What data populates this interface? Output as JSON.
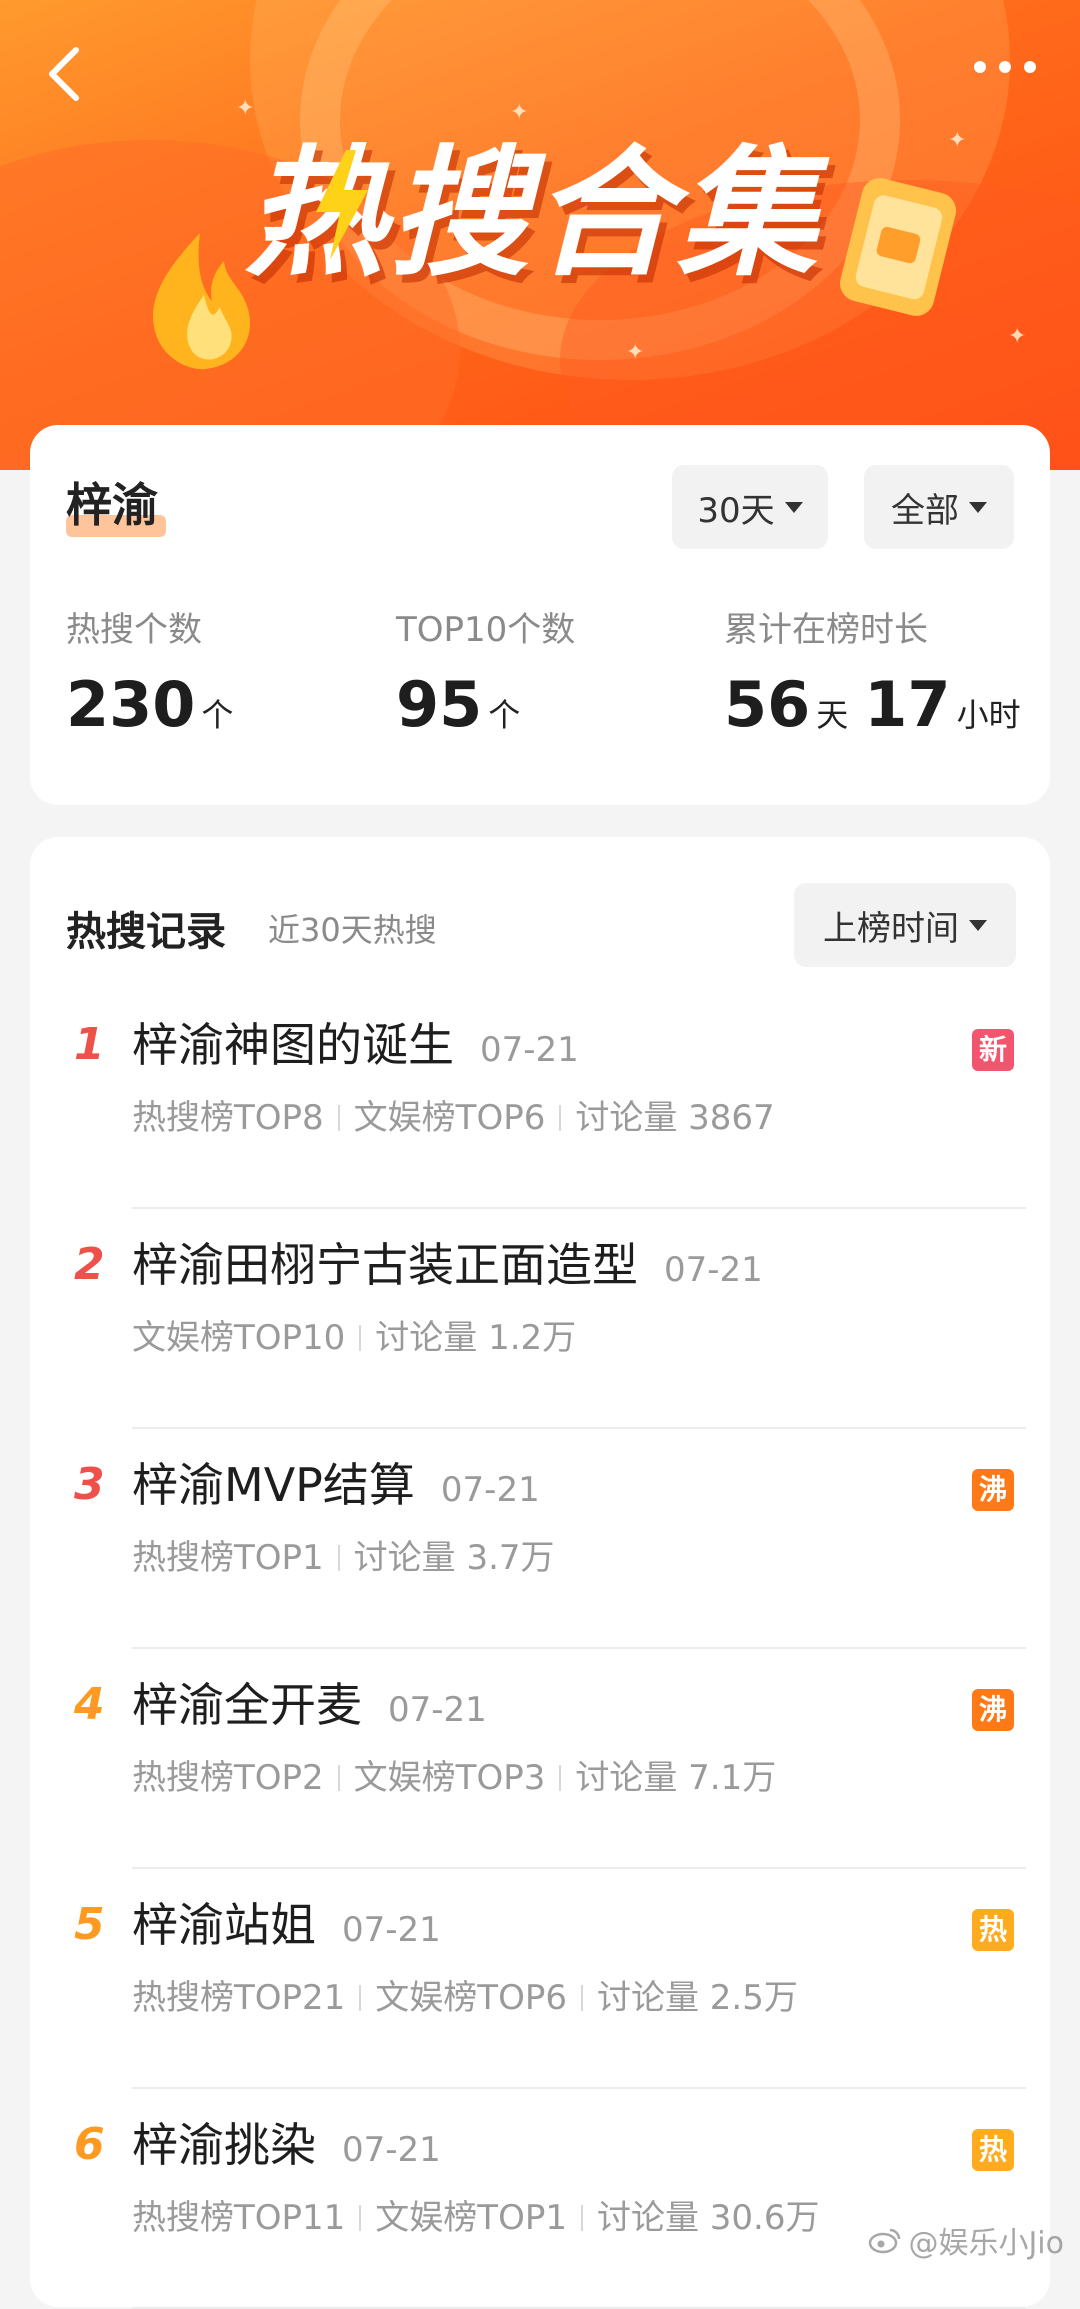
{
  "banner": {
    "title": "热搜合集"
  },
  "summary": {
    "name": "梓渝",
    "filter_days": "30天",
    "filter_scope": "全部",
    "stats": [
      {
        "label": "热搜个数",
        "value": "230",
        "unit": "个"
      },
      {
        "label": "TOP10个数",
        "value": "95",
        "unit": "个"
      },
      {
        "label": "累计在榜时长",
        "days": "56",
        "days_unit": "天",
        "hours": "17",
        "hours_unit": "小时"
      }
    ]
  },
  "records": {
    "title": "热搜记录",
    "subtitle": "近30天热搜",
    "sort_label": "上榜时间",
    "items": [
      {
        "rank": "1",
        "name": "梓渝神图的诞生",
        "date": "07-21",
        "meta": [
          "热搜榜TOP8",
          "文娱榜TOP6",
          "讨论量 3867"
        ],
        "tag": "新",
        "tag_color": "#f2556e",
        "rank_color": "#f0504a"
      },
      {
        "rank": "2",
        "name": "梓渝田栩宁古装正面造型",
        "date": "07-21",
        "meta": [
          "文娱榜TOP10",
          "讨论量 1.2万"
        ],
        "tag": "",
        "tag_color": "",
        "rank_color": "#f0504a"
      },
      {
        "rank": "3",
        "name": "梓渝MVP结算",
        "date": "07-21",
        "meta": [
          "热搜榜TOP1",
          "讨论量 3.7万"
        ],
        "tag": "沸",
        "tag_color": "#ff7a16",
        "rank_color": "#f0504a"
      },
      {
        "rank": "4",
        "name": "梓渝全开麦",
        "date": "07-21",
        "meta": [
          "热搜榜TOP2",
          "文娱榜TOP3",
          "讨论量 7.1万"
        ],
        "tag": "沸",
        "tag_color": "#ff7a16",
        "rank_color": "#ff9a20"
      },
      {
        "rank": "5",
        "name": "梓渝站姐",
        "date": "07-21",
        "meta": [
          "热搜榜TOP21",
          "文娱榜TOP6",
          "讨论量 2.5万"
        ],
        "tag": "热",
        "tag_color": "#ffab1e",
        "rank_color": "#ff9a20"
      },
      {
        "rank": "6",
        "name": "梓渝挑染",
        "date": "07-21",
        "meta": [
          "热搜榜TOP11",
          "文娱榜TOP1",
          "讨论量 30.6万"
        ],
        "tag": "热",
        "tag_color": "#ffab1e",
        "rank_color": "#ff9a20"
      }
    ]
  },
  "watermark": "@娱乐小Jio"
}
